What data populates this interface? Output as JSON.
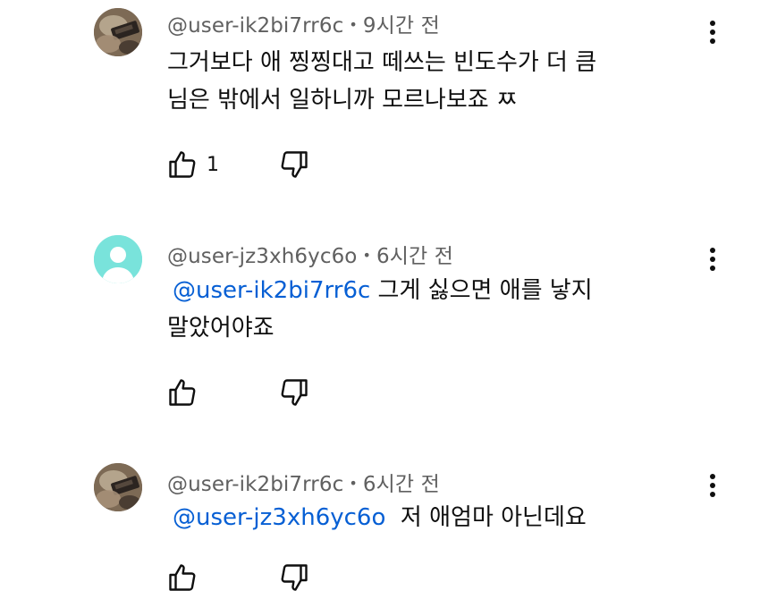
{
  "comments": [
    {
      "author": "@user-ik2bi7rr6c",
      "separator": "•",
      "time": "9시간 전",
      "lines": [
        "그거보다 애 찡찡대고 떼쓰는 빈도수가 더 큼",
        "님은 밖에서 일하니까 모르나보죠 ㅉ"
      ],
      "likes": "1",
      "avatar_icon": "user-photo-avatar"
    },
    {
      "author": "@user-jz3xh6yc6o",
      "separator": "•",
      "time": "6시간 전",
      "mention": "@user-ik2bi7rr6c",
      "line1_rest": " 그게 싫으면 애를 낳지",
      "line2": "말았어야죠",
      "likes": "",
      "avatar_icon": "default-person-avatar",
      "avatar_color": "#79e3db"
    },
    {
      "author": "@user-ik2bi7rr6c",
      "separator": "•",
      "time": "6시간 전",
      "mention": "@user-jz3xh6yc6o",
      "line1_rest": "  저 애엄마 아닌데요",
      "likes": "",
      "avatar_icon": "user-photo-avatar"
    }
  ],
  "icons": {
    "like": "thumbs-up-icon",
    "dislike": "thumbs-down-icon",
    "more": "more-vert-icon"
  },
  "colors": {
    "mention": "#065fd4",
    "meta": "#606060",
    "text": "#0f0f0f"
  }
}
